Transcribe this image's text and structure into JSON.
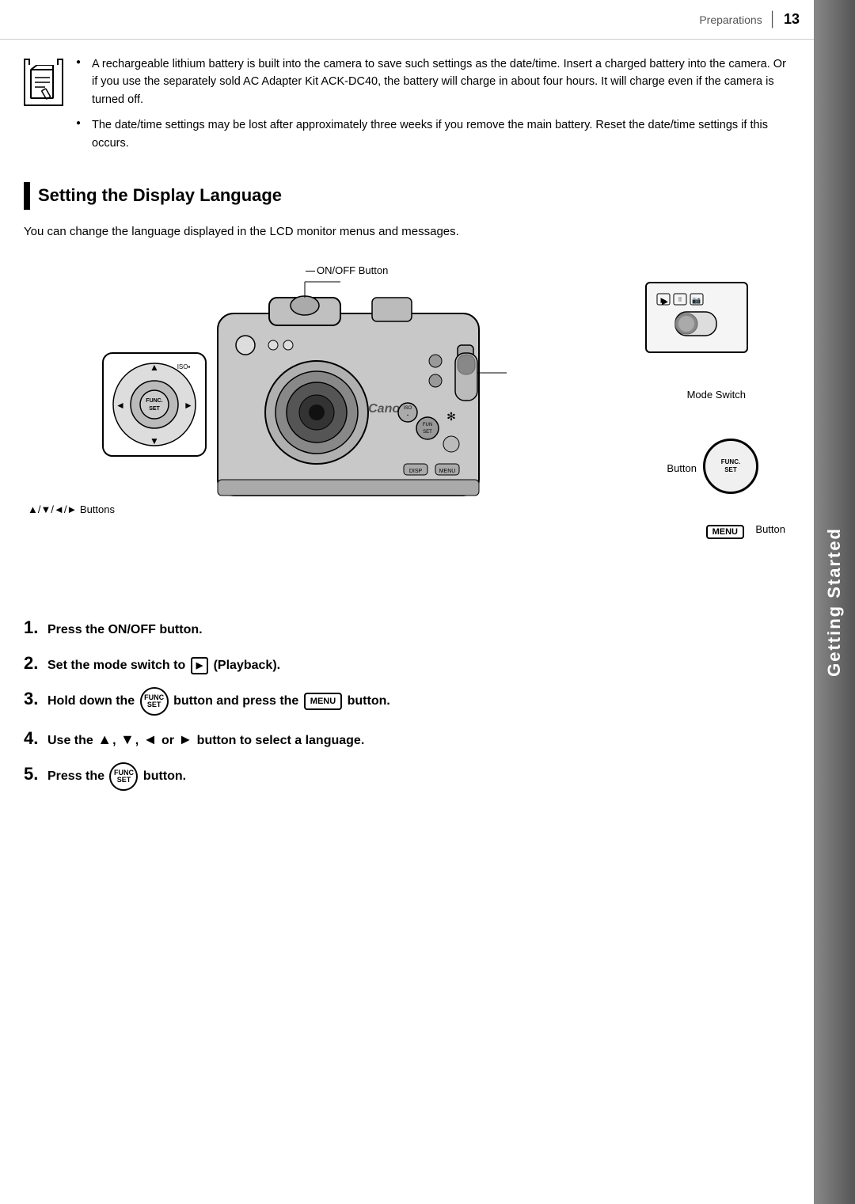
{
  "page": {
    "number": "13",
    "section_label": "Preparations",
    "side_tab": "Getting Started"
  },
  "notes": {
    "bullet1": "A rechargeable lithium battery is built into the camera to save such settings as the date/time. Insert a charged battery into the camera. Or if you use the separately sold AC Adapter Kit ACK-DC40, the battery will charge in about four hours. It will charge even if the camera is turned off.",
    "bullet2": "The date/time settings may be lost after approximately three weeks if you remove the main battery. Reset the date/time settings if this occurs."
  },
  "section": {
    "title": "Setting the Display Language",
    "description": "You can change the language displayed in the LCD monitor menus and messages."
  },
  "diagram": {
    "label_onoff": "ON/OFF Button",
    "label_mode_switch": "Mode Switch",
    "label_func_button": "Button",
    "label_menu_button": "Button",
    "label_arrows": "▲/▼/◄/► Buttons"
  },
  "steps": [
    {
      "number": "1",
      "text": "Press the ON/OFF button."
    },
    {
      "number": "2",
      "text": "Set the mode switch to  ▶  (Playback)."
    },
    {
      "number": "3",
      "text": "Hold down the  FUNC/SET  button and press the  MENU  button."
    },
    {
      "number": "4",
      "text": "Use the ▲, ▼, ◄ or ► button to select a language."
    },
    {
      "number": "5",
      "text": "Press the  FUNC/SET  button."
    }
  ]
}
